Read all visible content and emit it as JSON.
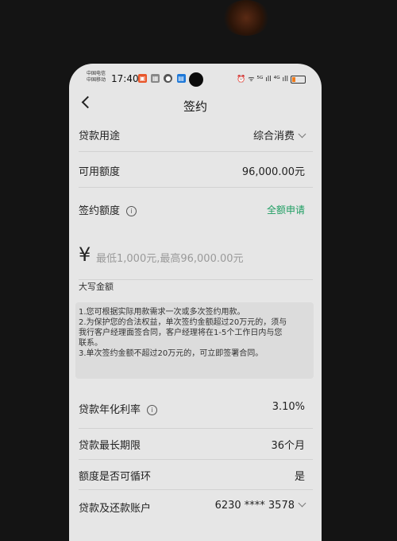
{
  "status_bar": {
    "carrier1": "中国电信",
    "carrier2": "中国移动",
    "time": "17:40",
    "right": "⏰ ᯤ ⁵ᴳ ıll ⁴ᴳ ıll"
  },
  "header": {
    "title": "签约"
  },
  "loan_purpose": {
    "label": "贷款用途",
    "value": "综合消费"
  },
  "available_amount": {
    "label": "可用额度",
    "value": "96,000.00元"
  },
  "sign_amount": {
    "label": "签约额度",
    "action": "全额申请",
    "currency": "¥",
    "placeholder": "最低1,000元,最高96,000.00元"
  },
  "uppercase_amount": {
    "label": "大写金额"
  },
  "notes": [
    "1.您可根据实际用款需求一次或多次签约用款。",
    "2.为保护您的合法权益，单次签约金额超过20万元的，须与",
    "我行客户经理面签合同，客户经理将在1-5个工作日内与您",
    "联系。",
    "3.单次签约金额不超过20万元的，可立即签署合同。"
  ],
  "annual_rate": {
    "label": "贷款年化利率",
    "value": "3.10%"
  },
  "max_term": {
    "label": "贷款最长期限",
    "value": "36个月"
  },
  "revolving": {
    "label": "额度是否可循环",
    "value": "是"
  },
  "account": {
    "label": "贷款及还款账户",
    "value": "6230 **** 3578"
  },
  "icons": {
    "info": "info-icon",
    "back": "back-arrow-icon",
    "dropdown": "chevron-down-icon"
  }
}
